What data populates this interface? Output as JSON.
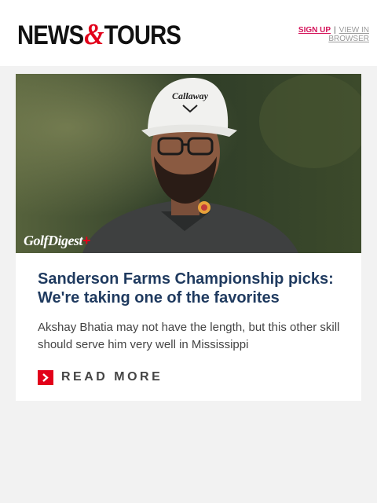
{
  "header": {
    "logo_left": "NEWS",
    "logo_amp": "&",
    "logo_right": "TOURS",
    "signup_label": "SIGN UP",
    "separator": "|",
    "view_in_browser_label": "VIEW IN BROWSER"
  },
  "article": {
    "image_brand_label": "GolfDigest",
    "image_brand_plus": "+",
    "cap_brand": "Callaway",
    "title": "Sanderson Farms Championship picks: We're taking one of the favorites",
    "dek": "Akshay Bhatia may not have the length, but this other skill should serve him very well in Mississippi",
    "read_more_label": "READ MORE"
  },
  "colors": {
    "accent_red": "#e2001a",
    "signup_pink": "#d4145a",
    "title_navy": "#1f3a5f",
    "page_bg": "#f2f2f2"
  }
}
